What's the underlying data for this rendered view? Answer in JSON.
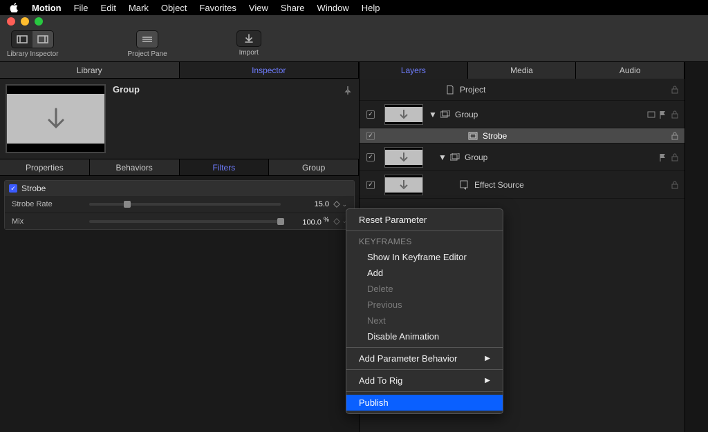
{
  "menu": {
    "app": "Motion",
    "items": [
      "File",
      "Edit",
      "Mark",
      "Object",
      "Favorites",
      "View",
      "Share",
      "Window",
      "Help"
    ]
  },
  "toolbar": {
    "libinsp_label": "Library   Inspector",
    "library_label": "Library",
    "inspector_label": "Inspector",
    "project_pane_label": "Project Pane",
    "import_label": "Import"
  },
  "left_tabs": {
    "library": "Library",
    "inspector": "Inspector"
  },
  "inspector": {
    "title": "Group",
    "subtabs": {
      "properties": "Properties",
      "behaviors": "Behaviors",
      "filters": "Filters",
      "group": "Group"
    },
    "filter": {
      "name": "Strobe",
      "rate_label": "Strobe Rate",
      "rate_value": "15.0",
      "mix_label": "Mix",
      "mix_value": "100.0",
      "mix_unit": "%"
    }
  },
  "right_tabs": {
    "layers": "Layers",
    "media": "Media",
    "audio": "Audio"
  },
  "layers": {
    "project": "Project",
    "group1": "Group",
    "strobe": "Strobe",
    "group2": "Group",
    "effect_source": "Effect Source"
  },
  "ctxmenu": {
    "reset": "Reset Parameter",
    "keyframes": "KEYFRAMES",
    "show_kf": "Show In Keyframe Editor",
    "add": "Add",
    "delete": "Delete",
    "previous": "Previous",
    "next": "Next",
    "disable": "Disable Animation",
    "add_param": "Add Parameter Behavior",
    "add_rig": "Add To Rig",
    "publish": "Publish"
  }
}
